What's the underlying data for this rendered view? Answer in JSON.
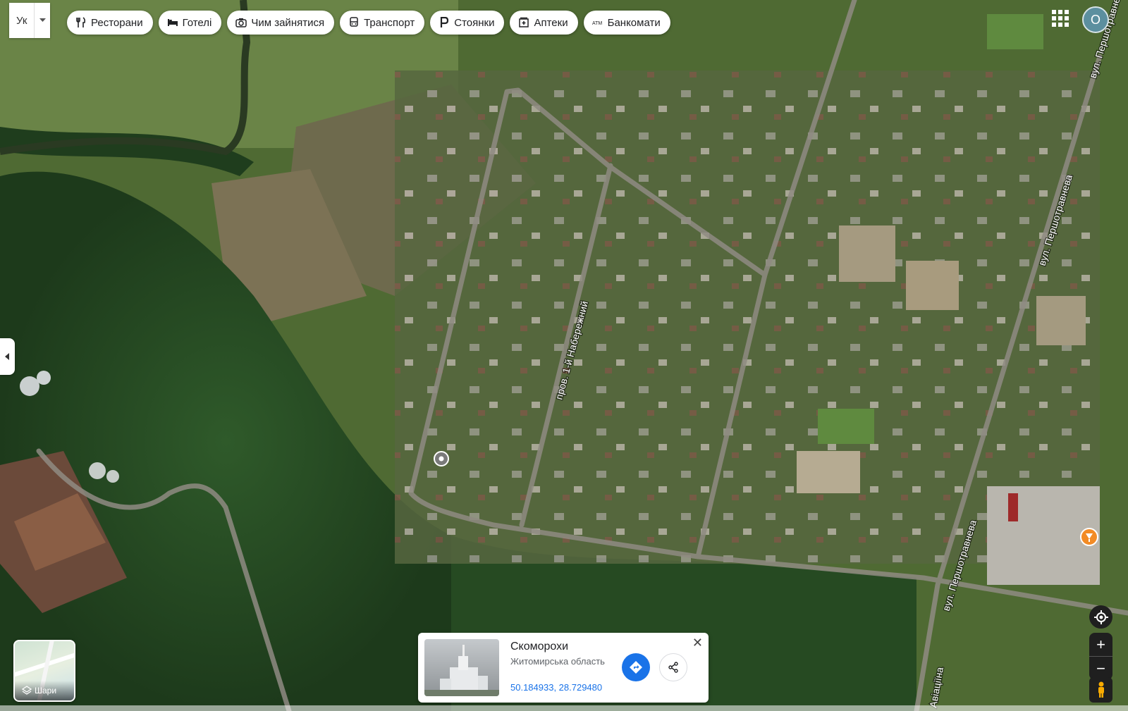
{
  "language_selector": {
    "label": "Ук"
  },
  "categories": [
    {
      "label": "Ресторани",
      "icon": "fork-knife-icon"
    },
    {
      "label": "Готелі",
      "icon": "bed-icon"
    },
    {
      "label": "Чим зайнятися",
      "icon": "camera-icon"
    },
    {
      "label": "Транспорт",
      "icon": "bus-icon"
    },
    {
      "label": "Стоянки",
      "icon": "parking-icon"
    },
    {
      "label": "Аптеки",
      "icon": "pharmacy-icon"
    },
    {
      "label": "Банкомати",
      "icon": "atm-icon"
    }
  ],
  "account": {
    "initial": "О"
  },
  "streets": {
    "pereulok": "пров. 1-й Набережний",
    "pershotravneva_top": "вул. Першотравнева",
    "pershotravneva_mid": "вул. Першотравнева",
    "pershotravneva_low": "вул. Першотравнева",
    "aviatsiina": "Авіаціїна"
  },
  "layers": {
    "label": "Шари"
  },
  "place_card": {
    "name": "Скоморохи",
    "region": "Житомирська область",
    "coordinates": "50.184933, 28.729480",
    "close_label": "✕"
  },
  "controls": {
    "zoom_in": "+",
    "zoom_out": "−"
  },
  "colors": {
    "accent": "#1a73e8",
    "marker_orange": "#f28b25"
  }
}
